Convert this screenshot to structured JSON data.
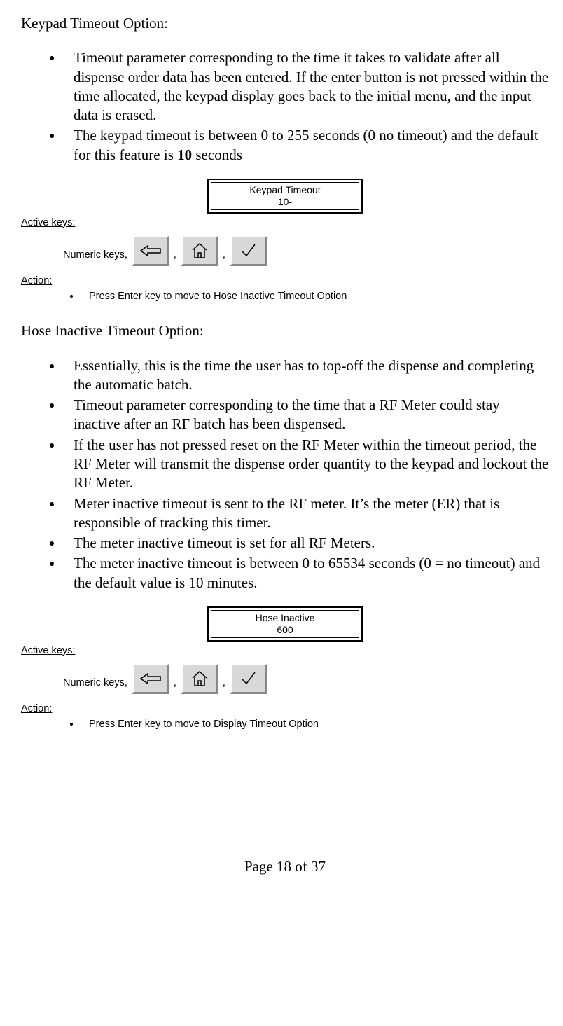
{
  "section1": {
    "heading": "Keypad Timeout Option:",
    "bullets": [
      {
        "text": "Timeout parameter corresponding to the time it takes to validate after all dispense order data has been entered. If the enter button is not pressed within the time allocated, the keypad display goes back to the initial menu, and the input data is erased."
      },
      {
        "prefix": "The keypad timeout is between 0 to 255 seconds (0 no timeout) and the default for this feature is ",
        "bold": "10",
        "suffix": " seconds"
      }
    ],
    "lcd": {
      "line1": "Keypad Timeout",
      "line2": "10-"
    },
    "active_keys_label": "Active keys:",
    "numeric_keys_label": "Numeric keys,",
    "comma": ",",
    "action_label": "Action:",
    "action_bullet": "Press Enter key to move to Hose Inactive Timeout Option"
  },
  "section2": {
    "heading": "Hose Inactive Timeout Option:",
    "bullets": [
      "Essentially, this is the time the user has to top-off the dispense and completing the automatic batch.",
      "Timeout parameter corresponding to the time that a RF Meter could stay inactive after an RF batch has been dispensed.",
      "If the user has not pressed reset on the RF Meter within the timeout period, the RF Meter will transmit the dispense order quantity to the keypad and lockout the RF Meter.",
      "Meter inactive timeout is sent to the RF meter. It’s the meter (ER) that is responsible of tracking this timer.",
      "The meter inactive timeout is set for all RF Meters.",
      "The meter inactive timeout is between 0 to 65534 seconds (0 = no timeout) and the default value is 10 minutes."
    ],
    "lcd": {
      "line1": "Hose Inactive",
      "line2": "600"
    },
    "active_keys_label": "Active keys:",
    "numeric_keys_label": "Numeric keys,",
    "comma": ",",
    "action_label": "Action:",
    "action_bullet": "Press Enter key to move to Display Timeout Option"
  },
  "footer": "Page 18 of 37"
}
